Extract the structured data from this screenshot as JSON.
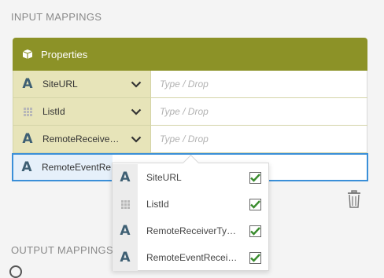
{
  "input_mappings_label": "INPUT MAPPINGS",
  "output_mappings_label": "OUTPUT MAPPINGS",
  "panel": {
    "title": "Properties",
    "header_color": "#8c9227"
  },
  "rows": [
    {
      "type": "text",
      "name": "SiteURL",
      "placeholder": "Type / Drop"
    },
    {
      "type": "lookup",
      "name": "ListId",
      "placeholder": "Type / Drop"
    },
    {
      "type": "text",
      "name": "RemoteReceive…",
      "placeholder": "Type / Drop"
    }
  ],
  "active_row": {
    "type": "text",
    "name": "RemoteEventRe"
  },
  "dropdown": {
    "items": [
      {
        "type": "text",
        "label": "SiteURL",
        "checked": true
      },
      {
        "type": "lookup",
        "label": "ListId",
        "checked": true
      },
      {
        "type": "text",
        "label": "RemoteReceiverTy…",
        "checked": true
      },
      {
        "type": "text",
        "label": "RemoteEventRecei…",
        "checked": true
      }
    ]
  },
  "icons": {
    "text_type": "A",
    "lookup_type": "grid-icon",
    "delete": "trash-icon",
    "header": "box-icon"
  },
  "colors": {
    "accent_blue": "#3a8fd8",
    "check_green": "#3a8c2e",
    "type_icon": "#3e5f73"
  }
}
